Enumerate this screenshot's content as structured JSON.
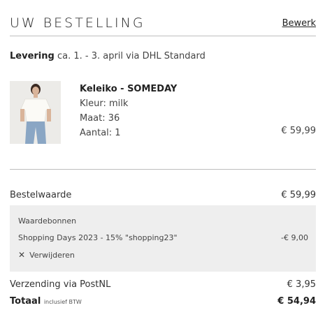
{
  "header": {
    "title": "UW BESTELLING",
    "edit_label": "Bewerk"
  },
  "delivery": {
    "label": "Levering",
    "text": "ca. 1. - 3. april via DHL Standard"
  },
  "product": {
    "name": "Keleiko - SOMEDAY",
    "color": "Kleur: milk",
    "size": "Maat: 36",
    "quantity": "Aantal: 1",
    "price": "€ 59,99"
  },
  "summary": {
    "order_value_label": "Bestelwaarde",
    "order_value": "€ 59,99",
    "vouchers_title": "Waardebonnen",
    "voucher_label": "Shopping Days 2023 - 15% \"shopping23\"",
    "voucher_amount": "-€ 9,00",
    "remove_label": "Verwijderen",
    "shipping_label": "Verzending via PostNL",
    "shipping_value": "€ 3,95",
    "total_label": "Totaal",
    "total_note": "inclusief BTW",
    "total_value": "€ 54,94"
  }
}
